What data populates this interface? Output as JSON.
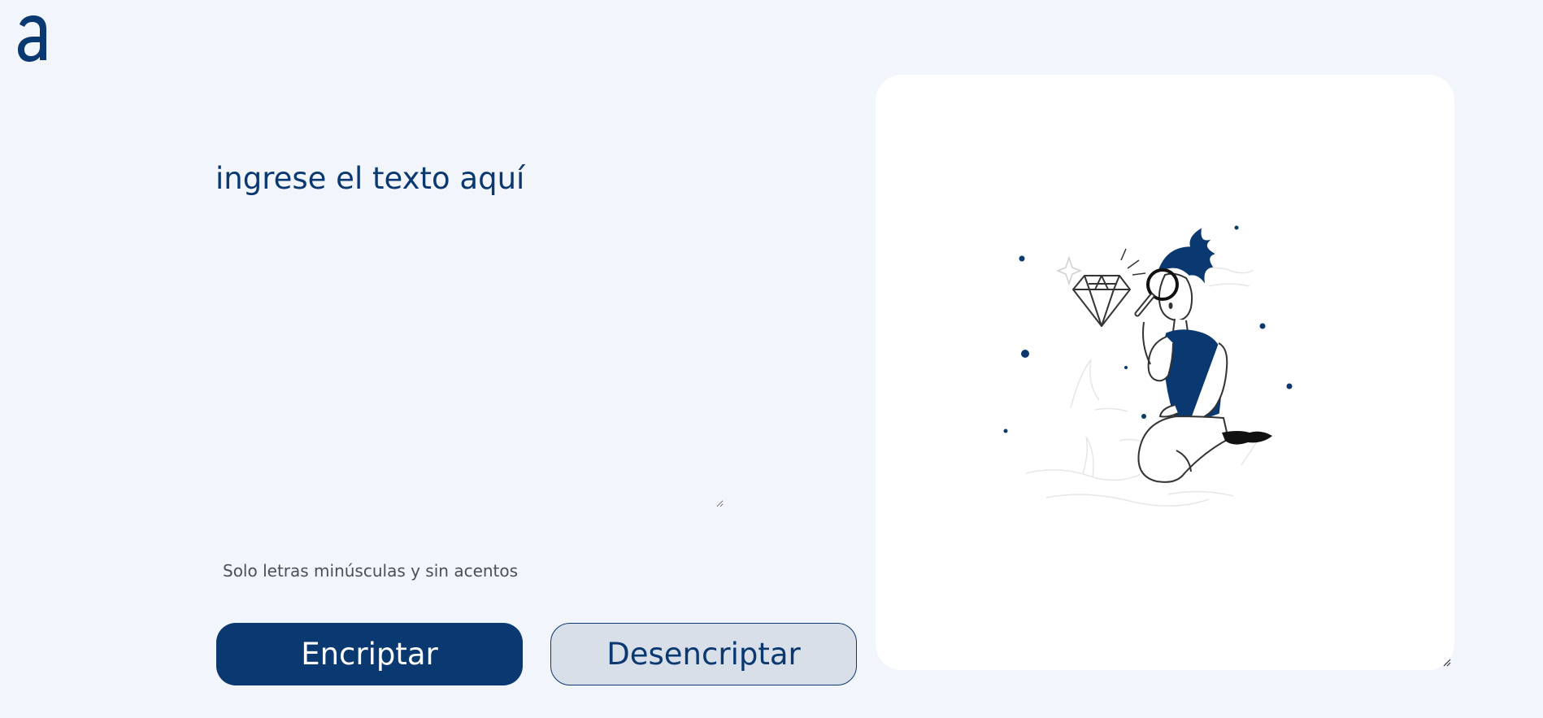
{
  "app": {
    "logo_icon": "alura-a-logo-icon",
    "accent_color": "#0A3871",
    "background_color": "#F3F5FC"
  },
  "input": {
    "placeholder": "ingrese el texto aquí",
    "value": ""
  },
  "hint": {
    "icon": "info-icon",
    "text": "Solo letras minúsculas y sin acentos"
  },
  "buttons": {
    "encrypt_label": "Encriptar",
    "decrypt_label": "Desencriptar"
  },
  "output": {
    "illustration": "person-with-magnifier-and-diamond-illustration",
    "value": ""
  }
}
